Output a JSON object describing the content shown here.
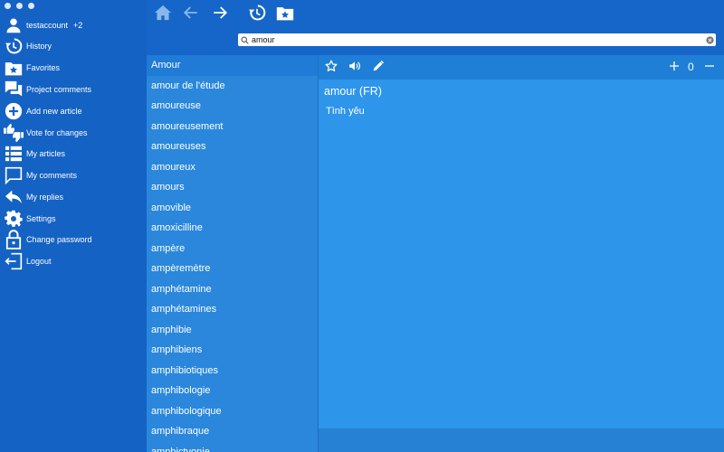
{
  "sidebar": {
    "account": {
      "name": "testaccount",
      "extra": "+2"
    },
    "items": [
      {
        "label": "History"
      },
      {
        "label": "Favorites"
      },
      {
        "label": "Project comments"
      },
      {
        "label": "Add new article"
      },
      {
        "label": "Vote for changes"
      },
      {
        "label": "My articles"
      },
      {
        "label": "My comments"
      },
      {
        "label": "My replies"
      },
      {
        "label": "Settings"
      },
      {
        "label": "Change password"
      },
      {
        "label": "Logout"
      }
    ]
  },
  "search": {
    "value": "amour"
  },
  "words": [
    "Amour",
    "amour de l'étude",
    "amoureuse",
    "amoureusement",
    "amoureuses",
    "amoureux",
    "amours",
    "amovible",
    "amoxicilline",
    "ampère",
    "ampèremètre",
    "amphétamine",
    "amphétamines",
    "amphibie",
    "amphibiens",
    "amphibiotiques",
    "amphibologie",
    "amphibologique",
    "amphibraque",
    "amphictyonie"
  ],
  "detail": {
    "headword": "amour (FR)",
    "translation": "Tình yêu",
    "counter": "0"
  }
}
